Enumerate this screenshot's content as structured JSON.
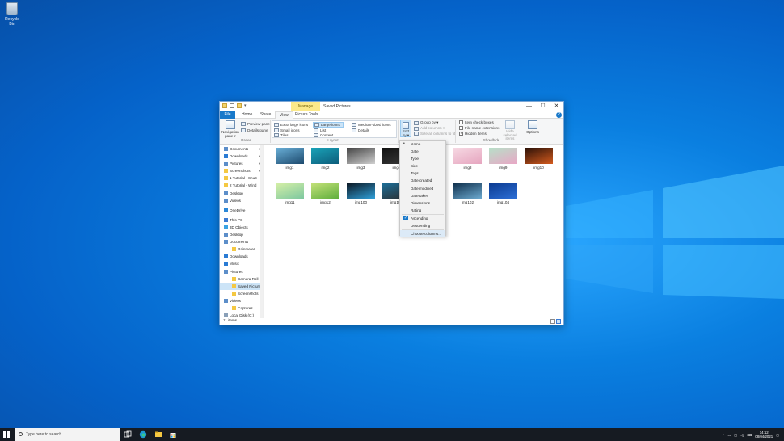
{
  "desktop": {
    "recycle_bin_label": "Recycle Bin"
  },
  "window": {
    "manage_tab": "Manage",
    "title": "Saved Pictures",
    "qat_marker": "▾",
    "controls": {
      "minimize": "—",
      "maximize": "☐",
      "close": "✕"
    }
  },
  "tabs": {
    "file": "File",
    "home": "Home",
    "share": "Share",
    "view": "View",
    "picture_tools": "Picture Tools",
    "help": "?"
  },
  "ribbon": {
    "panes": {
      "navigation_pane": "Navigation pane ▾",
      "preview_pane": "Preview pane",
      "details_pane": "Details pane",
      "group_label": "Panes"
    },
    "layout": {
      "extra_large": "Extra large icons",
      "large": "Large icons",
      "medium": "Medium-sized icons",
      "small": "Small icons",
      "list": "List",
      "details": "Details",
      "tiles": "Tiles",
      "content": "Content",
      "group_label": "Layout"
    },
    "current_view": {
      "sort_by": "Sort by ▾",
      "group_by": "Group by ▾",
      "add_columns": "Add columns ▾",
      "size_columns": "Size all columns to fit"
    },
    "show_hide": {
      "item_check_boxes": "Item check boxes",
      "file_name_extensions": "File name extensions",
      "hidden_items": "Hidden items",
      "hide_selected": "Hide selected items",
      "options": "Options",
      "group_label": "Show/hide"
    }
  },
  "nav": {
    "items": [
      {
        "label": "Documents",
        "pinned": true,
        "level": 1
      },
      {
        "label": "Downloads",
        "pinned": true,
        "level": 1
      },
      {
        "label": "Pictures",
        "pinned": true,
        "level": 1
      },
      {
        "label": "Screenshots",
        "pinned": true,
        "level": 1
      },
      {
        "label": "1 Tutorial - Shutt",
        "pinned": false,
        "level": 1
      },
      {
        "label": "2 Tutorial - Wind",
        "pinned": false,
        "level": 1
      },
      {
        "label": "Desktop",
        "pinned": false,
        "level": 1
      },
      {
        "label": "Videos",
        "pinned": false,
        "level": 1
      },
      {
        "label": "OneDrive",
        "pinned": false,
        "level": 0
      },
      {
        "label": "This PC",
        "pinned": false,
        "level": 0
      },
      {
        "label": "3D Objects",
        "pinned": false,
        "level": 1
      },
      {
        "label": "Desktop",
        "pinned": false,
        "level": 1
      },
      {
        "label": "Documents",
        "pinned": false,
        "level": 1
      },
      {
        "label": "Rainmeter",
        "pinned": false,
        "level": 2
      },
      {
        "label": "Downloads",
        "pinned": false,
        "level": 1
      },
      {
        "label": "Music",
        "pinned": false,
        "level": 1
      },
      {
        "label": "Pictures",
        "pinned": false,
        "level": 1
      },
      {
        "label": "Camera Roll",
        "pinned": false,
        "level": 2
      },
      {
        "label": "Saved Pictures",
        "pinned": false,
        "level": 2,
        "selected": true
      },
      {
        "label": "Screenshots",
        "pinned": false,
        "level": 2
      },
      {
        "label": "Videos",
        "pinned": false,
        "level": 1
      },
      {
        "label": "Captures",
        "pinned": false,
        "level": 2
      },
      {
        "label": "Local Disk (C:)",
        "pinned": false,
        "level": 1
      }
    ]
  },
  "files": [
    {
      "name": "img1",
      "colors": [
        "#6ab0d8",
        "#1d4a6e"
      ]
    },
    {
      "name": "img2",
      "colors": [
        "#1aa3b8",
        "#0d5c7a"
      ]
    },
    {
      "name": "img3",
      "colors": [
        "#444444",
        "#cfcfcf"
      ]
    },
    {
      "name": "img4",
      "colors": [
        "#111111",
        "#3a3a3a"
      ]
    },
    {
      "name": "img5",
      "colors": [
        "#f6d9e3",
        "#e6a5bf"
      ]
    },
    {
      "name": "img6",
      "colors": [
        "#b7e0c8",
        "#e9a7c6"
      ]
    },
    {
      "name": "img8",
      "colors": [
        "#f6d9e3",
        "#e6a5bf"
      ]
    },
    {
      "name": "img9",
      "colors": [
        "#b7e0c8",
        "#e9a7c6"
      ]
    },
    {
      "name": "img10",
      "colors": [
        "#2a1108",
        "#d35a1d"
      ]
    },
    {
      "name": "img11",
      "colors": [
        "#d7f0a6",
        "#7ec8a0"
      ]
    },
    {
      "name": "img12",
      "colors": [
        "#c5e27a",
        "#5fae3c"
      ]
    },
    {
      "name": "img100",
      "colors": [
        "#0b1520",
        "#2f9fd8"
      ]
    },
    {
      "name": "img101",
      "colors": [
        "#1c6f9a",
        "#2d2d2d"
      ]
    },
    {
      "name": "img102",
      "colors": [
        "#0e2d49",
        "#6ca9cf"
      ]
    },
    {
      "name": "img104",
      "colors": [
        "#0b3a8f",
        "#2d6fd6"
      ]
    }
  ],
  "status": {
    "count": "11 items"
  },
  "sort_menu": {
    "items": [
      "Name",
      "Date",
      "Type",
      "Size",
      "Tags",
      "Date created",
      "Date modified",
      "Date taken",
      "Dimensions",
      "Rating"
    ],
    "bullet_item_index": 0,
    "order": [
      "Ascending",
      "Descending"
    ],
    "checked_order_index": 0,
    "choose_columns": "Choose columns..."
  },
  "taskbar": {
    "search_placeholder": "Type here to search",
    "time": "14:12",
    "date": "08/04/2021"
  },
  "colors": {
    "accent": "#1979ca",
    "selection": "#cce4f7",
    "manage_tab": "#fbe98a",
    "taskbar": "#161b22"
  }
}
